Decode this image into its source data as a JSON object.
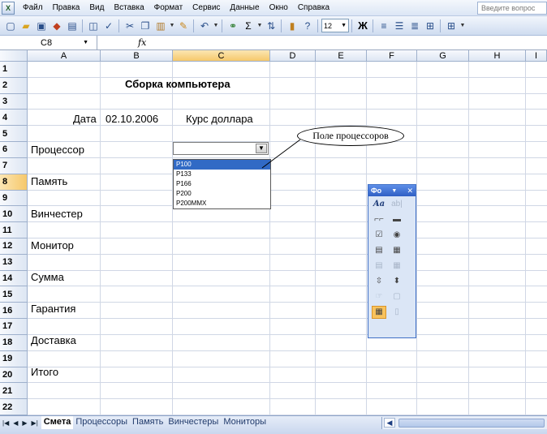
{
  "menu": {
    "items": [
      "Файл",
      "Правка",
      "Вид",
      "Вставка",
      "Формат",
      "Сервис",
      "Данные",
      "Окно",
      "Справка"
    ],
    "ask_placeholder": "Введите вопрос"
  },
  "toolbar": {
    "font_size": "12",
    "bold_label": "Ж"
  },
  "formula_bar": {
    "name_box": "C8",
    "fx_label": "fx"
  },
  "columns": [
    "A",
    "B",
    "C",
    "D",
    "E",
    "F",
    "G",
    "H",
    "I"
  ],
  "selected_column": "C",
  "rows": [
    "1",
    "2",
    "3",
    "4",
    "5",
    "6",
    "7",
    "8",
    "9",
    "10",
    "11",
    "12",
    "13",
    "14",
    "15",
    "16",
    "17",
    "18",
    "19",
    "20",
    "21",
    "22"
  ],
  "selected_row": "8",
  "cells": {
    "title": "Сборка компьютера",
    "date_label": "Дата",
    "date_value": "02.10.2006",
    "rate_label": "Курс доллара",
    "processor": "Процессор",
    "memory": "Память",
    "hdd": "Винчестер",
    "monitor": "Монитор",
    "sum": "Сумма",
    "warranty": "Гарантия",
    "delivery": "Доставка",
    "total": "Итого"
  },
  "combo": {
    "selected_value": "",
    "options": [
      "P100",
      "P133",
      "P166",
      "P200",
      "P200MMX"
    ],
    "highlighted": "P100"
  },
  "callout": {
    "text": "Поле процессоров"
  },
  "forms_toolbar": {
    "title": "Фо"
  },
  "sheet_tabs": [
    "Смета",
    "Процессоры",
    "Память",
    "Винчестеры",
    "Мониторы"
  ],
  "active_tab": "Смета"
}
